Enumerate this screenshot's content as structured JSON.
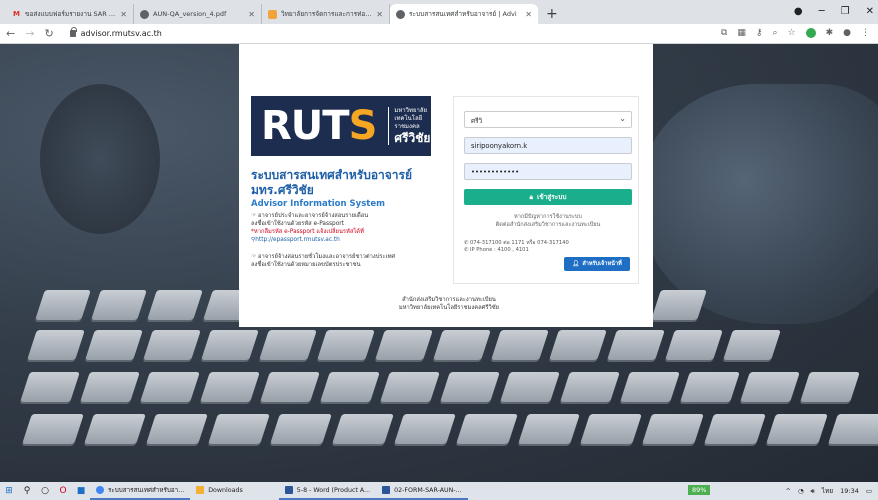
{
  "browser": {
    "tabs": [
      {
        "title": "ขอส่งแบบฟอร์มรายงาน SAR ระดับหลั",
        "favicon": "gmail-icon",
        "active": false
      },
      {
        "title": "AUN-QA_version_4.pdf",
        "favicon": "chrome-icon",
        "active": false
      },
      {
        "title": "วิทยาลัยการจัดการและการท่องเที่ยว ลิ",
        "favicon": "college-icon",
        "active": false
      },
      {
        "title": "ระบบสารสนเทศสำหรับอาจารย์ | Advi",
        "favicon": "chrome-icon",
        "active": true
      }
    ],
    "new_tab": "+",
    "url": "advisor.rmutsv.ac.th"
  },
  "logo": {
    "main": "RUTS",
    "side_line1": "มหาวิทยาลัย",
    "side_line2": "เทคโนโลยีราชมงคล",
    "side_big": "ศรีวิชัย"
  },
  "system": {
    "title": "ระบบสารสนเทศสำหรับอาจารย์ มทร.ศรีวิชัย",
    "subtitle": "Advisor Information System",
    "note1_line1": "อาจารย์ประจำและอาจารย์จ้างสอนรายเดือน",
    "note1_line2": "ลงชื่อเข้าใช้งานด้วยรหัส e-Passport",
    "note1_red": "*หากลืมรหัส e-Passport แจ้งเปลี่ยนรหัสได้ที่",
    "note1_link": "http://epassport.rmutsv.ac.th",
    "note2_line1": "อาจารย์จ้างสอนรายชั่วโมงและอาจารย์ชาวต่างประเทศ",
    "note2_line2": "ลงชื่อเข้าใช้งานด้วยหมายเลขบัตรประชาชน"
  },
  "form": {
    "select_value": "ศรีวิ",
    "username": "siripoonyakorn.k",
    "password": "••••••••••••",
    "login_label": "เข้าสู่ระบบ",
    "note_line1": "หากมีปัญหาการใช้งานระบบ",
    "note_line2": "ติดต่อสำนักส่งเสริมวิชาการและงานทะเบียน",
    "phone1": "074-317100 ต่อ 1171 หรือ 074-317140",
    "phone2": "IP Phone : 4100 , 4101",
    "staff_label": "สำหรับเจ้าหน้าที่"
  },
  "footer": {
    "line1": "สำนักส่งเสริมวิชาการและงานทะเบียน",
    "line2": "มหาวิทยาลัยเทคโนโลยีราชมงคลศรีวิชัย"
  },
  "taskbar": {
    "apps": [
      {
        "label": "ระบบสารสนเทศสำหรับอา...",
        "color": "#4285f4"
      },
      {
        "label": "Downloads",
        "color": "#f2b134"
      },
      {
        "label": "5-8 - Word (Product A...",
        "color": "#2b579a"
      },
      {
        "label": "02-FORM-SAR-AUN-...",
        "color": "#2b579a"
      }
    ],
    "battery": "89%",
    "lang": "ไทย",
    "time": "19:34"
  },
  "colors": {
    "brand_navy": "#1c2d4f",
    "accent_orange": "#f5a623",
    "login_green": "#1aae8c",
    "staff_blue": "#1e6fc4",
    "title_blue": "#1e5fa8"
  }
}
